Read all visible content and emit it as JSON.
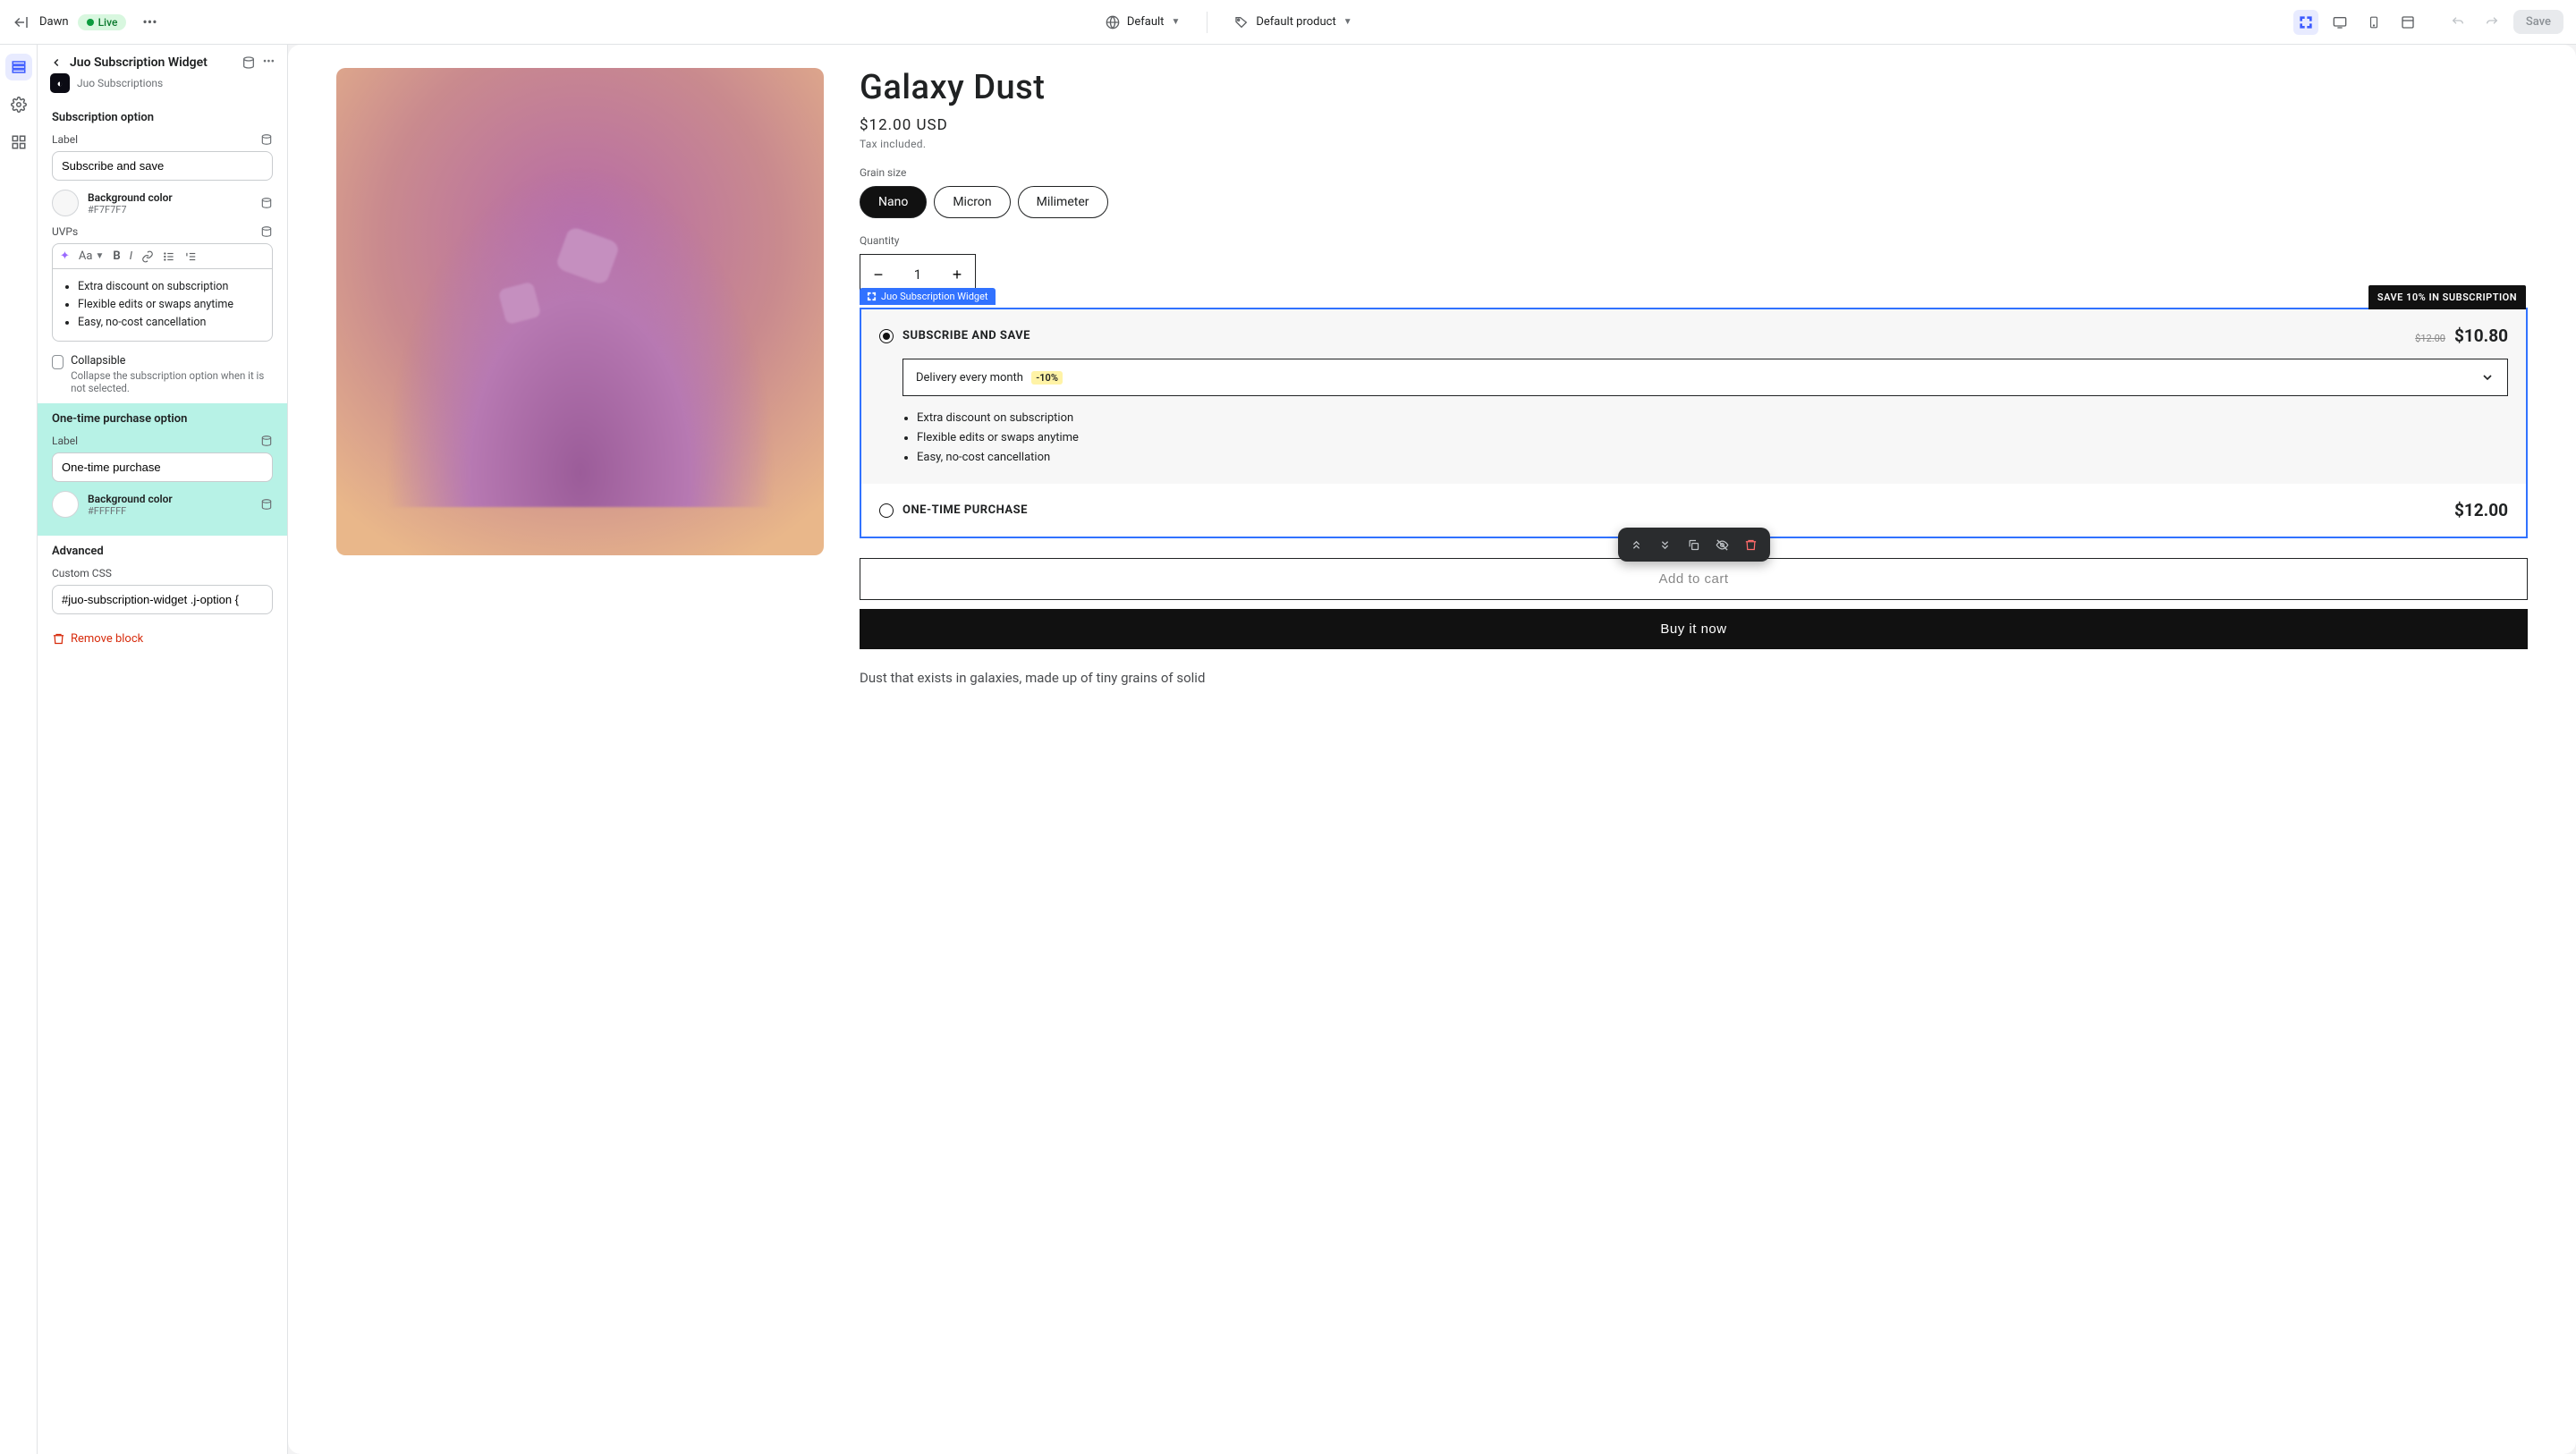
{
  "topbar": {
    "theme_name": "Dawn",
    "live_badge": "Live",
    "language_label": "Default",
    "product_label": "Default product",
    "save_label": "Save"
  },
  "panel": {
    "block_title": "Juo Subscription Widget",
    "app_name": "Juo Subscriptions",
    "subscription_section": {
      "title": "Subscription option",
      "label_field": "Label",
      "label_value": "Subscribe and save",
      "bg_label": "Background color",
      "bg_value": "#F7F7F7",
      "uvps_label": "UVPs",
      "uvps": [
        "Extra discount on subscription",
        "Flexible edits or swaps anytime",
        "Easy, no-cost cancellation"
      ],
      "collapsible_label": "Collapsible",
      "collapsible_help": "Collapse the subscription option when it is not selected."
    },
    "onetime_section": {
      "title": "One-time purchase option",
      "label_field": "Label",
      "label_value": "One-time purchase",
      "bg_label": "Background color",
      "bg_value": "#FFFFFF"
    },
    "advanced_section": {
      "title": "Advanced",
      "css_label": "Custom CSS",
      "css_value": "#juo-subscription-widget .j-option {"
    },
    "remove_label": "Remove block"
  },
  "product": {
    "title": "Galaxy Dust",
    "price": "$12.00 USD",
    "tax_note": "Tax included.",
    "variant_label": "Grain size",
    "variants": [
      "Nano",
      "Micron",
      "Milimeter"
    ],
    "quantity_label": "Quantity",
    "quantity_value": "1",
    "widget_tag": "Juo Subscription Widget",
    "save_banner": "SAVE 10% IN SUBSCRIPTION",
    "subscribe_option": {
      "label": "SUBSCRIBE AND SAVE",
      "old_price": "$12.00",
      "new_price": "$10.80",
      "frequency": "Delivery every month",
      "discount": "-10%",
      "uvps": [
        "Extra discount on subscription",
        "Flexible edits or swaps anytime",
        "Easy, no-cost cancellation"
      ]
    },
    "onetime_option": {
      "label": "ONE-TIME PURCHASE",
      "price": "$12.00"
    },
    "add_to_cart": "Add to cart",
    "buy_now": "Buy it now",
    "description": "Dust that exists in galaxies, made up of tiny grains of solid"
  }
}
